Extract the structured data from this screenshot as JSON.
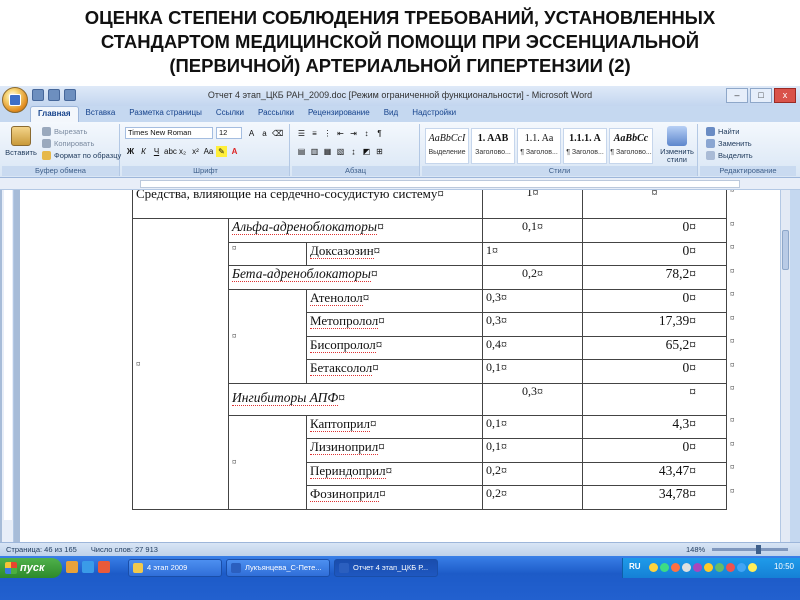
{
  "slide": {
    "title_lines": [
      "ОЦЕНКА СТЕПЕНИ СОБЛЮДЕНИЯ ТРЕБОВАНИЙ, УСТАНОВЛЕННЫХ",
      "СТАНДАРТОМ  МЕДИЦИНСКОЙ ПОМОЩИ ПРИ ЭССЕНЦИАЛЬНОЙ",
      "(ПЕРВИЧНОЙ) АРТЕРИАЛЬНОЙ ГИПЕРТЕНЗИИ (2)"
    ]
  },
  "window": {
    "title": "Отчет 4 этап_ЦКБ РАН_2009.doc [Режим ограниченной функциональности] - Microsoft Word",
    "controls": [
      "–",
      "□",
      "x"
    ]
  },
  "tabs": [
    "Главная",
    "Вставка",
    "Разметка страницы",
    "Ссылки",
    "Рассылки",
    "Рецензирование",
    "Вид",
    "Надстройки"
  ],
  "ribbon": {
    "clipboard": {
      "paste": "Вставить",
      "cut": "Вырезать",
      "copy": "Копировать",
      "format_painter": "Формат по образцу",
      "label": "Буфер обмена"
    },
    "font": {
      "name": "Times New Roman",
      "size": "12",
      "label": "Шрифт"
    },
    "paragraph": {
      "label": "Абзац"
    },
    "styles": {
      "items": [
        {
          "sample": "AaBbCcI",
          "name": "Выделение"
        },
        {
          "sample": "1. AAB",
          "name": "Заголово..."
        },
        {
          "sample": "1.1. Aa",
          "name": "¶ Заголов..."
        },
        {
          "sample": "1.1.1. A",
          "name": "¶ Заголов..."
        },
        {
          "sample": "AaBbCc",
          "name": "¶ Заголово..."
        }
      ],
      "change": "Изменить стили",
      "label": "Стили"
    },
    "editing": {
      "find": "Найти",
      "replace": "Заменить",
      "select": "Выделить",
      "label": "Редактирование"
    }
  },
  "table": {
    "section_row": {
      "label": "Средства, влияющие на сердечно-сосудистую систему",
      "value": "1"
    },
    "rows": [
      {
        "group": "Альфа-адреноблокаторы",
        "freq": "0,1",
        "ued": "0"
      },
      {
        "drug": "Доксазозин",
        "freq": "1",
        "ued": "0"
      },
      {
        "group": "Бета-адреноблокаторы",
        "freq": "0,2",
        "ued": "78,2"
      },
      {
        "drug": "Атенолол",
        "freq": "0,3",
        "ued": "0"
      },
      {
        "drug": "Метопролол",
        "freq": "0,3",
        "ued": "17,39"
      },
      {
        "drug": "Бисопролол",
        "freq": "0,4",
        "ued": "65,2"
      },
      {
        "drug": "Бетаксолол",
        "freq": "0,1",
        "ued": "0"
      },
      {
        "group": "Ингибиторы АПФ",
        "freq": "0,3",
        "ued": ""
      },
      {
        "drug": "Каптоприл",
        "freq": "0,1",
        "ued": "4,3"
      },
      {
        "drug": "Лизиноприл",
        "freq": "0,1",
        "ued": "0"
      },
      {
        "drug": "Периндоприл",
        "freq": "0,2",
        "ued": "43,47"
      },
      {
        "drug": "Фозиноприл",
        "freq": "0,2",
        "ued": "34,78"
      }
    ]
  },
  "statusbar": {
    "page": "Страница: 46 из 165",
    "words": "Число слов: 27 913",
    "zoom": "148%"
  },
  "taskbar": {
    "start": "пуск",
    "tasks": [
      "4 этап 2009",
      "Лукъянцева_С-Пете...",
      "Отчет 4 этап_ЦКБ Р..."
    ],
    "lang": "RU",
    "clock": "10:50"
  }
}
